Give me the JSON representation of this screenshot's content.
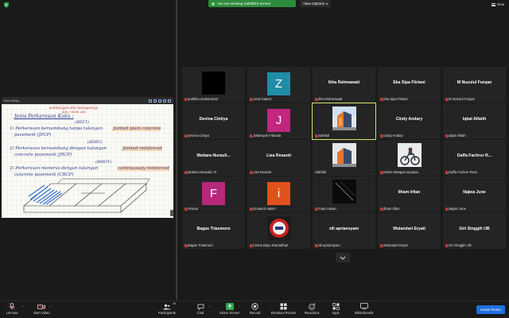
{
  "top_bar": {
    "share_notice": "You are viewing Safrilah's screen",
    "view_options": "View Options",
    "view_label": "View"
  },
  "shared_screen": {
    "tablet_title": "Notes Writing",
    "notes": {
      "heading": "Jenis Perkerasan Kaku :",
      "note_top_1": "sambungan ada tulangannya",
      "note_top_2": "ada / tidak ada",
      "line1_code": "(BBTT)",
      "line1": "1) Perkerasan bersambung tanpa tulangan",
      "line1_tag": "Jointed plain concrete",
      "line1_sub": "pavement (JPCP)",
      "line2_code": "(BDBT)",
      "line2": "2) Perkerasan bersambung dengan tulangan",
      "line2_tag": "Jointed reinforced",
      "line2_sub": "concrete pavement (JRCP)",
      "line3_code": "(BMDT)",
      "line3": "3) Perkerasan menerus dengan tulangan",
      "line3_tag": "continuously reinforced",
      "line3_sub": "concrete pavement (CRCP)"
    }
  },
  "gallery": {
    "tiles": [
      {
        "name": "andikha muhammad",
        "display": "",
        "type": "dark"
      },
      {
        "name": "zoom baa04",
        "display": "Z",
        "type": "avatar",
        "color": "#1f8da8"
      },
      {
        "name": "Ikha Rahmawati",
        "display": "Ikha Rahmawati",
        "type": "text"
      },
      {
        "name": "Eka Sipa Fitriani",
        "display": "Eka Sipa Fitriani",
        "type": "text"
      },
      {
        "name": "M Nuzulul Furqan",
        "display": "M Nuzulul Furqan",
        "type": "text"
      },
      {
        "name": "Devina Cintiya",
        "display": "Devina Cintiya",
        "type": "text"
      },
      {
        "name": "Jofansyah Firlanda",
        "display": "J",
        "type": "avatar",
        "color": "#c2267e"
      },
      {
        "name": "Safrilah",
        "display": "",
        "type": "photo-building",
        "active": true
      },
      {
        "name": "Cindy Andary",
        "display": "Cindy Andary",
        "type": "text"
      },
      {
        "name": "Iqbal Alfatih",
        "display": "Iqbal Alfatih",
        "type": "text"
      },
      {
        "name": "Mutiara Nurauli...",
        "label": "Mutiara Nuraulia .R",
        "display": "Mutiara Nurauli...",
        "type": "text"
      },
      {
        "name": "Lisa Rosanti",
        "display": "Lisa Rosanti",
        "type": "text"
      },
      {
        "name": "Safrilah",
        "display": "",
        "type": "photo-building-plain"
      },
      {
        "name": "Kelvin Wangsa suryana",
        "display": "",
        "type": "photo-bike"
      },
      {
        "name": "Daffa Fachrur R...",
        "label": "Daffa Fachrur Reza",
        "display": "Daffa Fachrur R...",
        "type": "text"
      },
      {
        "name": "Firman",
        "display": "F",
        "type": "avatar",
        "color": "#b5287c"
      },
      {
        "name": "Itznainul Hakim",
        "display": "i",
        "type": "avatar",
        "color": "#e2511c"
      },
      {
        "name": "Fuad Hasan",
        "display": "",
        "type": "photo-dark"
      },
      {
        "name": "Ilham Irfian",
        "display": "Ilham Irfian",
        "type": "text"
      },
      {
        "name": "Najwa June",
        "display": "Najwa June",
        "type": "text"
      },
      {
        "name": "Bagas Triasmoro",
        "display": "Bagas Triasmoro",
        "type": "text"
      },
      {
        "name": "Krisna Bayu Ramadhan",
        "display": "",
        "type": "photo-logo"
      },
      {
        "name": "zili apriansyam",
        "display": "zili apriansyam",
        "type": "text"
      },
      {
        "name": "Wulandari Eryati",
        "display": "Wulandari Eryati",
        "type": "text"
      },
      {
        "name": "Giri Singgih UB",
        "display": "Giri Singgih UB",
        "type": "text"
      }
    ]
  },
  "toolbar": {
    "unmute": "Unmute",
    "start_video": "Start Video",
    "participants": "Participants",
    "participants_count": "26",
    "chat": "Chat",
    "share_screen": "Share Screen",
    "record": "Record",
    "breakout_rooms": "Breakout Rooms",
    "reactions": "Reactions",
    "apps": "Apps",
    "whiteboards": "Whiteboards",
    "leave_room": "Leave Room"
  },
  "colors": {
    "share_green": "#2d8c3c",
    "leave_blue": "#1f6fe0",
    "active_speaker": "#d9e36a",
    "muted_red": "#e04040"
  }
}
